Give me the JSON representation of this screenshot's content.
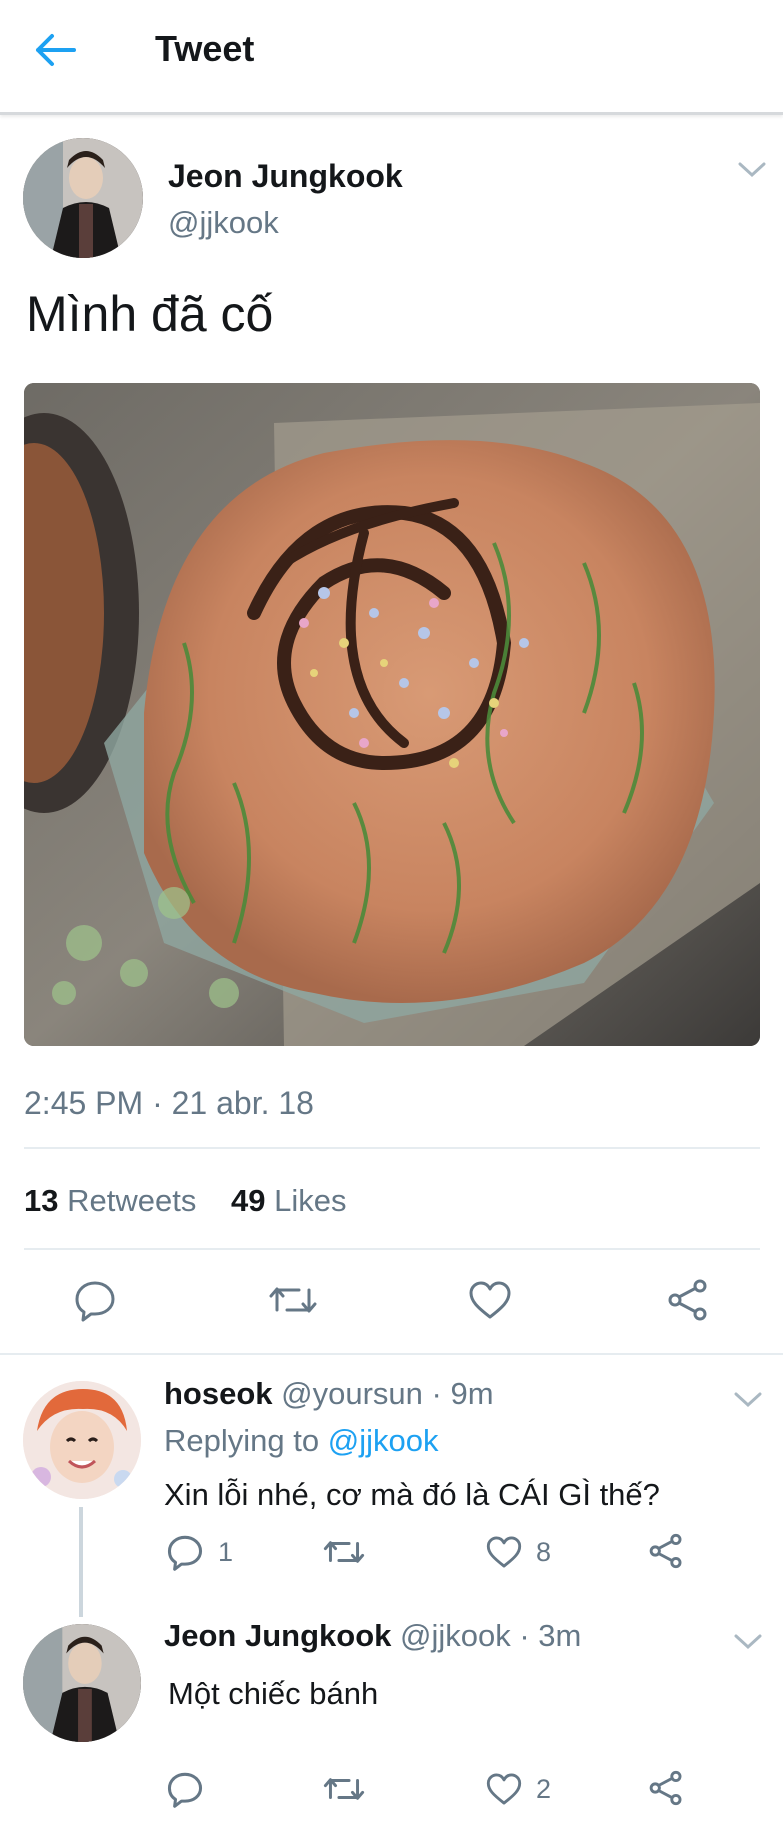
{
  "header": {
    "title": "Tweet",
    "back_icon": "arrow-left-icon"
  },
  "colors": {
    "accent": "#1da1f2",
    "secondary_text": "#657786",
    "primary_text": "#14171a"
  },
  "main_tweet": {
    "author_name": "Jeon Jungkook",
    "handle": "@jjkook",
    "text": "Mình đã cố",
    "timestamp": "2:45 PM · 21 abr. 18",
    "retweets_count": "13",
    "retweets_label": "Retweets",
    "likes_count": "49",
    "likes_label": "Likes"
  },
  "replies": [
    {
      "author_name": "hoseok",
      "meta": "@yoursun · 9m",
      "replying_prefix": "Replying to ",
      "replying_mention": "@jjkook",
      "text": "Xin lỗi nhé, cơ mà đó là CÁI GÌ thế?",
      "reply_count": "1",
      "like_count": "8"
    },
    {
      "author_name": "Jeon Jungkook",
      "meta": "@jjkook · 3m",
      "text": "Một chiếc bánh",
      "like_count": "2"
    }
  ]
}
